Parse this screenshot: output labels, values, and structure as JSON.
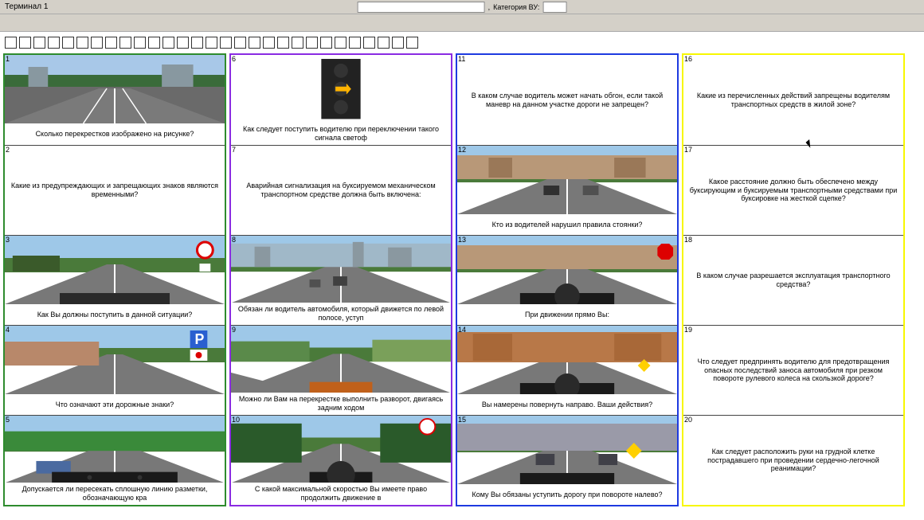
{
  "header": {
    "terminal_label": "Терминал 1",
    "category_label": "Категория ВУ:"
  },
  "progress_boxes": 29,
  "columns": [
    {
      "color": "green",
      "cells": [
        {
          "n": "1",
          "scene": "intersection",
          "text": "Сколько перекрестков изображено на рисунке?"
        },
        {
          "n": "2",
          "scene": "none",
          "text": "Какие из предупреждающих и запрещающих знаков являются временными?"
        },
        {
          "n": "3",
          "scene": "road_sign",
          "text": "Как Вы должны поступить в данной ситуации?"
        },
        {
          "n": "4",
          "scene": "parking",
          "text": "Что означают эти дорожные знаки?"
        },
        {
          "n": "5",
          "scene": "rural",
          "text": "Допускается ли пересекать сплошную линию разметки, обозначающую кра"
        }
      ]
    },
    {
      "color": "purple",
      "cells": [
        {
          "n": "6",
          "scene": "traffic_light",
          "text": "Как следует поступить водителю при переключении такого сигнала светоф"
        },
        {
          "n": "7",
          "scene": "none",
          "text": "Аварийная сигнализация на буксируемом механическом транспортном средстве должна быть включена:"
        },
        {
          "n": "8",
          "scene": "city_wide",
          "text": "Обязан ли водитель автомобиля, который движется по левой полосе, уступ"
        },
        {
          "n": "9",
          "scene": "turn",
          "text": "Можно ли Вам на перекрестке выполнить разворот, двигаясь задним ходом"
        },
        {
          "n": "10",
          "scene": "forest",
          "text": "С какой максимальной скоростью Вы имеете право продолжить движение в"
        }
      ]
    },
    {
      "color": "blue",
      "cells": [
        {
          "n": "11",
          "scene": "none",
          "text": "В каком случае водитель может начать обгон, если такой маневр на данном участке дороги не запрещен?"
        },
        {
          "n": "12",
          "scene": "street_park",
          "text": "Кто из водителей нарушил правила стоянки?"
        },
        {
          "n": "13",
          "scene": "stop",
          "text": "При движении прямо Вы:"
        },
        {
          "n": "14",
          "scene": "building",
          "text": "Вы намерены повернуть направо. Ваши действия?"
        },
        {
          "n": "15",
          "scene": "priority",
          "text": "Кому Вы обязаны уступить дорогу при повороте налево?"
        }
      ]
    },
    {
      "color": "yellow",
      "cells": [
        {
          "n": "16",
          "scene": "none",
          "text": "Какие из перечисленных действий запрещены водителям транспортных средств в жилой зоне?"
        },
        {
          "n": "17",
          "scene": "none",
          "text": "Какое расстояние должно быть обеспечено между буксирующим и буксируемым транспортными средствами при буксировке на жесткой сцепке?"
        },
        {
          "n": "18",
          "scene": "none",
          "text": "В каком случае разрешается эксплуатация транспортного средства?"
        },
        {
          "n": "19",
          "scene": "none",
          "text": "Что следует предпринять водителю для предотвращения опасных последствий заноса автомобиля при резком повороте рулевого колеса на скользкой дороге?"
        },
        {
          "n": "20",
          "scene": "none",
          "text": "Как следует расположить руки на грудной клетке пострадавшего при проведении сердечно-легочной реанимации?"
        }
      ]
    }
  ]
}
